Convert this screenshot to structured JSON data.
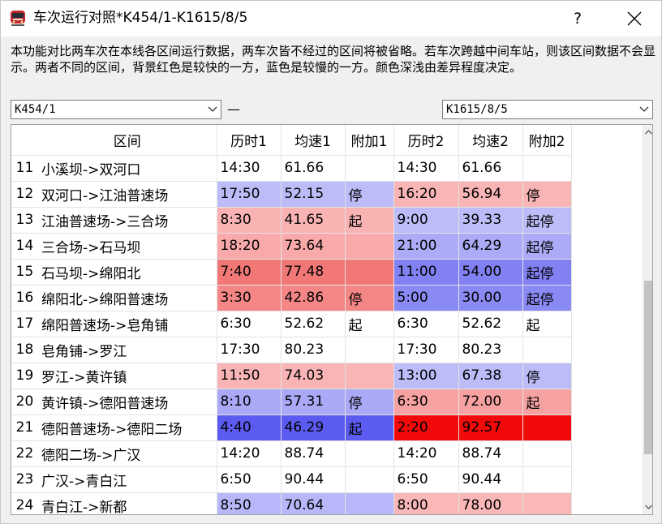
{
  "window": {
    "title": "车次运行对照*K454/1-K1615/8/5",
    "help_label": "?"
  },
  "description": "本功能对比两车次在本线各区间运行数据，两车次皆不经过的区间将被省略。若车次跨越中间车站，则该区间数据不会显示。两者不同的区间，背景红色是较快的一方，蓝色是较慢的一方。颜色深浅由差异程度决定。",
  "train_selectors": {
    "left_value": "K454/1",
    "separator": "—",
    "right_value": "K1615/8/5"
  },
  "table": {
    "columns": [
      "",
      "区间",
      "历时1",
      "均速1",
      "附加1",
      "历时2",
      "均速2",
      "附加2"
    ],
    "rows": [
      {
        "n": "11",
        "seg": "小溪坝->双河口",
        "t1": "14:30",
        "v1": "61.66",
        "a1": "",
        "t2": "14:30",
        "v2": "61.66",
        "a2": "",
        "c1": "#ffffff",
        "c2": "#ffffff"
      },
      {
        "n": "12",
        "seg": "双河口->江油普速场",
        "t1": "17:50",
        "v1": "52.15",
        "a1": "停",
        "t2": "16:20",
        "v2": "56.94",
        "a2": "停",
        "c1": "#bcbcf9",
        "c2": "#f9b5b5"
      },
      {
        "n": "13",
        "seg": "江油普速场->三合场",
        "t1": "8:30",
        "v1": "41.65",
        "a1": "起",
        "t2": "9:00",
        "v2": "39.33",
        "a2": "起停",
        "c1": "#f9b3b3",
        "c2": "#bcbcf9"
      },
      {
        "n": "14",
        "seg": "三合场->石马坝",
        "t1": "18:20",
        "v1": "73.64",
        "a1": "",
        "t2": "21:00",
        "v2": "64.29",
        "a2": "起停",
        "c1": "#f9a9a9",
        "c2": "#ababf7"
      },
      {
        "n": "15",
        "seg": "石马坝->绵阳北",
        "t1": "7:40",
        "v1": "77.48",
        "a1": "",
        "t2": "11:00",
        "v2": "54.00",
        "a2": "起停",
        "c1": "#f27878",
        "c2": "#8181f3"
      },
      {
        "n": "16",
        "seg": "绵阳北->绵阳普速场",
        "t1": "3:30",
        "v1": "42.86",
        "a1": "停",
        "t2": "5:00",
        "v2": "30.00",
        "a2": "起停",
        "c1": "#f48686",
        "c2": "#8a8af5"
      },
      {
        "n": "17",
        "seg": "绵阳普速场->皂角铺",
        "t1": "6:30",
        "v1": "52.62",
        "a1": "起",
        "t2": "6:30",
        "v2": "52.62",
        "a2": "起",
        "c1": "#ffffff",
        "c2": "#ffffff"
      },
      {
        "n": "18",
        "seg": "皂角铺->罗江",
        "t1": "17:30",
        "v1": "80.23",
        "a1": "",
        "t2": "17:30",
        "v2": "80.23",
        "a2": "",
        "c1": "#ffffff",
        "c2": "#ffffff"
      },
      {
        "n": "19",
        "seg": "罗江->黄许镇",
        "t1": "11:50",
        "v1": "74.03",
        "a1": "",
        "t2": "13:00",
        "v2": "67.38",
        "a2": "停",
        "c1": "#f9b5b5",
        "c2": "#bcbcf9"
      },
      {
        "n": "20",
        "seg": "黄许镇->德阳普速场",
        "t1": "8:10",
        "v1": "57.31",
        "a1": "停",
        "t2": "6:30",
        "v2": "72.00",
        "a2": "起",
        "c1": "#a9a9f7",
        "c2": "#f7a2a2"
      },
      {
        "n": "21",
        "seg": "德阳普速场->德阳二场",
        "t1": "4:40",
        "v1": "46.29",
        "a1": "起",
        "t2": "2:20",
        "v2": "92.57",
        "a2": "",
        "c1": "#5b5bf2",
        "c2": "#f20a0a"
      },
      {
        "n": "22",
        "seg": "德阳二场->广汉",
        "t1": "14:20",
        "v1": "88.74",
        "a1": "",
        "t2": "14:20",
        "v2": "88.74",
        "a2": "",
        "c1": "#ffffff",
        "c2": "#ffffff"
      },
      {
        "n": "23",
        "seg": "广汉->青白江",
        "t1": "6:50",
        "v1": "90.44",
        "a1": "",
        "t2": "6:50",
        "v2": "90.44",
        "a2": "",
        "c1": "#ffffff",
        "c2": "#ffffff"
      },
      {
        "n": "24",
        "seg": "青白江->新都",
        "t1": "8:50",
        "v1": "70.64",
        "a1": "",
        "t2": "8:00",
        "v2": "78.00",
        "a2": "",
        "c1": "#b7b7f9",
        "c2": "#f9b7b7"
      }
    ]
  },
  "scrollbar": {
    "up_icon": "chevron-up-icon",
    "down_icon": "chevron-down-icon"
  }
}
